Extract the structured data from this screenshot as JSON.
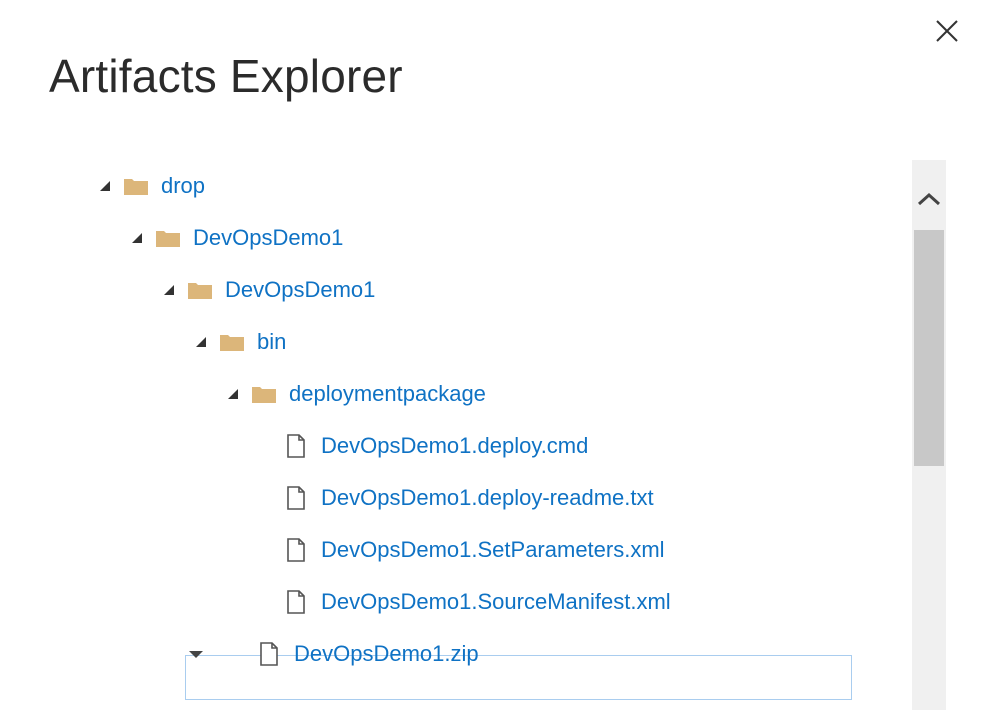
{
  "dialog": {
    "title": "Artifacts Explorer",
    "close_icon": "close-icon"
  },
  "tree": {
    "items": [
      {
        "label": "drop",
        "type": "folder",
        "level": 0,
        "expander": "expanded"
      },
      {
        "label": "DevOpsDemo1",
        "type": "folder",
        "level": 1,
        "expander": "expanded"
      },
      {
        "label": "DevOpsDemo1",
        "type": "folder",
        "level": 2,
        "expander": "expanded"
      },
      {
        "label": "bin",
        "type": "folder",
        "level": 3,
        "expander": "expanded"
      },
      {
        "label": "deploymentpackage",
        "type": "folder",
        "level": 4,
        "expander": "expanded"
      },
      {
        "label": "DevOpsDemo1.deploy.cmd",
        "type": "file",
        "level": 5,
        "expander": "none"
      },
      {
        "label": "DevOpsDemo1.deploy-readme.txt",
        "type": "file",
        "level": 5,
        "expander": "none"
      },
      {
        "label": "DevOpsDemo1.SetParameters.xml",
        "type": "file",
        "level": 5,
        "expander": "none"
      },
      {
        "label": "DevOpsDemo1.SourceManifest.xml",
        "type": "file",
        "level": 5,
        "expander": "none"
      },
      {
        "label": "DevOpsDemo1.zip",
        "type": "file",
        "level": 5,
        "expander": "actions",
        "selected": true
      }
    ]
  },
  "scrollbar": {
    "up_icon": "chevron-up-icon"
  },
  "colors": {
    "link": "#0f72c4",
    "folder": "#dcb67a",
    "selection_border": "#a9cdef",
    "scrollbar_track": "#f0f0f0",
    "scrollbar_thumb": "#c8c8c8"
  }
}
